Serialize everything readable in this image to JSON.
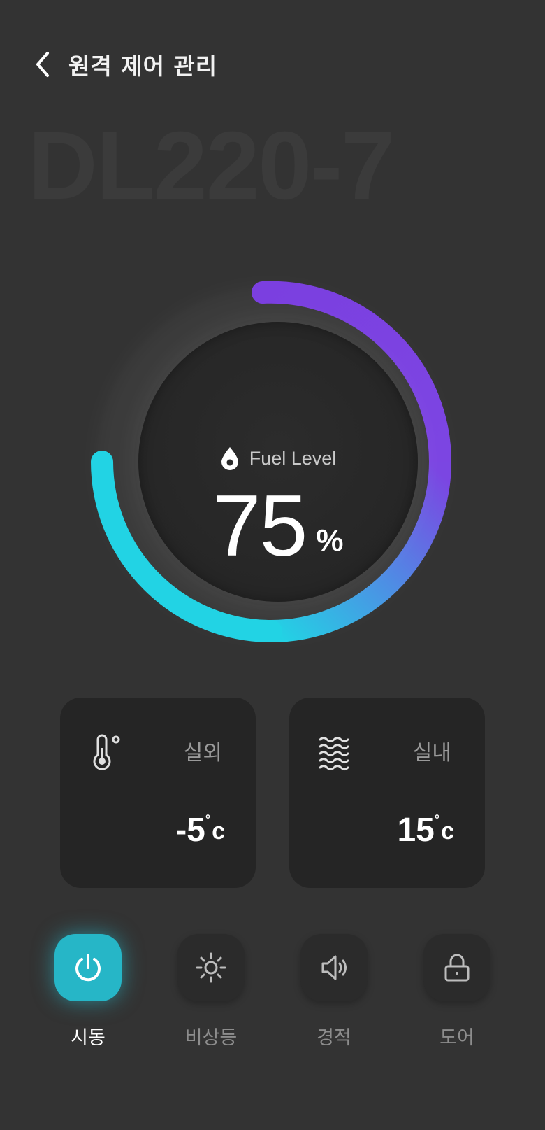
{
  "header": {
    "title": "원격 제어 관리"
  },
  "model_name": "DL220-7",
  "fuel": {
    "label": "Fuel Level",
    "value": "75",
    "unit": "%",
    "level_fraction": 0.75
  },
  "cards": [
    {
      "label": "실외",
      "value": "-5",
      "deg": "°",
      "unit": "c",
      "icon": "thermometer-icon"
    },
    {
      "label": "실내",
      "value": "15",
      "deg": "°",
      "unit": "c",
      "icon": "heat-waves-icon"
    }
  ],
  "controls": [
    {
      "label": "시동",
      "icon": "power-icon",
      "active": true
    },
    {
      "label": "비상등",
      "icon": "sun-icon",
      "active": false
    },
    {
      "label": "경적",
      "icon": "speaker-icon",
      "active": false
    },
    {
      "label": "도어",
      "icon": "lock-icon",
      "active": false
    }
  ],
  "colors": {
    "accent_cyan": "#22d3e4",
    "accent_purple": "#7b3fe0",
    "active_button": "#26b6c7"
  }
}
